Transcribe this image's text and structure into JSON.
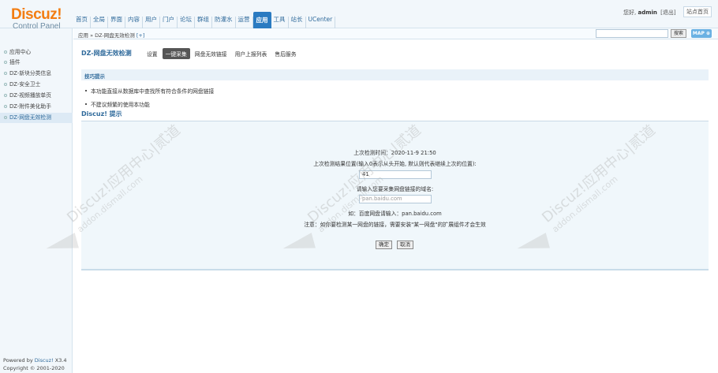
{
  "header": {
    "logo": "Discuz!",
    "logo_sub": "Control Panel",
    "nav": [
      "首页",
      "全局",
      "界面",
      "内容",
      "用户",
      "门户",
      "论坛",
      "群组",
      "防灌水",
      "运营",
      "应用",
      "工具",
      "站长",
      "UCenter"
    ],
    "active_nav_index": 10,
    "greeting": "您好,",
    "username": "admin",
    "logout": "[退出]",
    "site_home": "站点首页"
  },
  "breadcrumb": {
    "text": "应用 » DZ-网盘无效检测",
    "plus": "[+]",
    "search_button": "搜索",
    "map_button": "MAP ⊕"
  },
  "sidebar": {
    "items": [
      {
        "label": "应用中心",
        "active": false
      },
      {
        "label": "插件",
        "active": false
      },
      {
        "label": "DZ-新块分类信息",
        "active": false
      },
      {
        "label": "DZ-安全卫士",
        "active": false
      },
      {
        "label": "DZ-视频播放单页",
        "active": false
      },
      {
        "label": "DZ-附件美化助手",
        "active": false
      },
      {
        "label": "DZ-网盘无效检测",
        "active": true
      }
    ],
    "powered_prefix": "Powered by",
    "powered_brand": "Discuz!",
    "powered_version": "X3.4",
    "copyright": "Copyright © 2001-2020"
  },
  "main": {
    "plugin_title": "DZ-网盘无效检测",
    "tabs": [
      {
        "label": "设置",
        "active": false
      },
      {
        "label": "一键采集",
        "active": true
      },
      {
        "label": "网盘无效链接",
        "active": false
      },
      {
        "label": "用户上报列表",
        "active": false
      },
      {
        "label": "售后服务",
        "active": false
      }
    ],
    "tips_title": "技巧提示",
    "tips": [
      "本功能直接从数据库中查找所有符合条件的网盘链接",
      "不建议频繁的使用本功能"
    ],
    "section_title": "Discuz! 提示",
    "last_check": "上次检测时间：2020-11-9 21:50",
    "position_label": "上次检测结果位置(输入0表示从头开始, 默认则代表继续上次的位置):",
    "position_value": "41",
    "domain_label": "请输入您要采集网盘链接的域名:",
    "domain_placeholder": "pan.baidu.com",
    "example": "如：百度网盘请输入：pan.baidu.com",
    "notice": "注意：如你要检测某一网盘的链接，需要安装\"某一网盘\"的扩展组件才会生效",
    "confirm": "确定",
    "cancel": "取消"
  },
  "watermark": {
    "line1": "Discuz!应用中心|贰道",
    "line2": "addon.dismall.com"
  }
}
